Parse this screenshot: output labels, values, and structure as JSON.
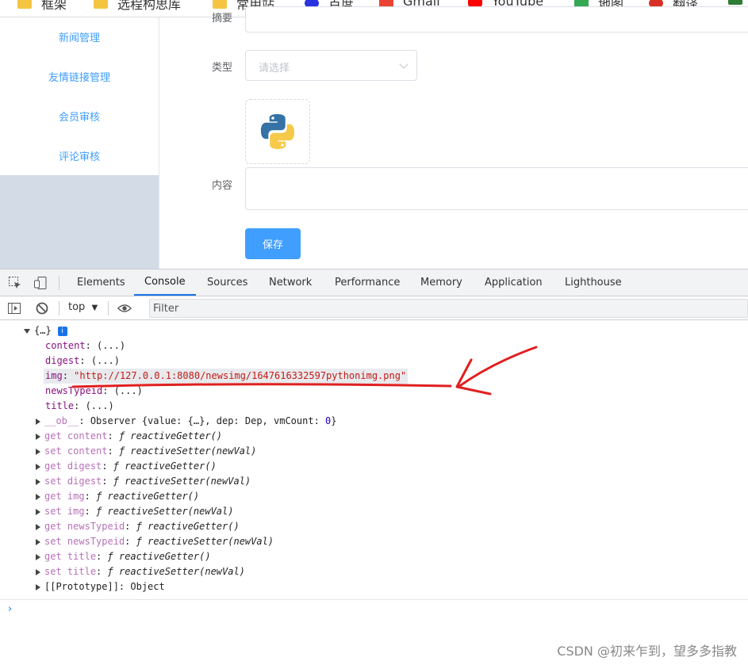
{
  "bookmarks": [
    {
      "label": "框架",
      "icon": "folder-icon"
    },
    {
      "label": "选程构思库",
      "icon": "folder-icon"
    },
    {
      "label": "常用站",
      "icon": "folder-icon"
    },
    {
      "label": "百度",
      "icon": "baidu-icon"
    },
    {
      "label": "Gmail",
      "icon": "gmail-icon"
    },
    {
      "label": "YouTube",
      "icon": "youtube-icon"
    },
    {
      "label": "地图",
      "icon": "maps-icon"
    },
    {
      "label": "翻译",
      "icon": "translate-icon"
    }
  ],
  "sidebar": {
    "items": [
      {
        "label": "新闻管理"
      },
      {
        "label": "友情链接管理"
      },
      {
        "label": "会员审核"
      },
      {
        "label": "评论审核"
      }
    ]
  },
  "form": {
    "digest_label": "摘要",
    "type_label": "类型",
    "type_placeholder": "请选择",
    "content_label": "内容",
    "save_label": "保存"
  },
  "devtools": {
    "tabs": [
      "Elements",
      "Console",
      "Sources",
      "Network",
      "Performance",
      "Memory",
      "Application",
      "Lighthouse"
    ],
    "active_tab": "Console",
    "context": "top",
    "filter_placeholder": "Filter"
  },
  "console": {
    "object_header": "{…}",
    "info_badge": "i",
    "props": [
      {
        "key": "content",
        "value": "(...)"
      },
      {
        "key": "digest",
        "value": "(...)"
      },
      {
        "key": "img",
        "value": "\"http://127.0.0.1:8080/newsimg/1647616332597pythonimg.png\""
      },
      {
        "key": "newsTypeid",
        "value": "(...)"
      },
      {
        "key": "title",
        "value": "(...)"
      }
    ],
    "observer": {
      "key": "__ob__",
      "value": "Observer {value: {…}, dep: Dep, vmCount: ",
      "count": "0",
      "close": "}"
    },
    "accessors": [
      {
        "kind": "get",
        "name": "content",
        "fn": "reactiveGetter()"
      },
      {
        "kind": "set",
        "name": "content",
        "fn": "reactiveSetter(newVal)"
      },
      {
        "kind": "get",
        "name": "digest",
        "fn": "reactiveGetter()"
      },
      {
        "kind": "set",
        "name": "digest",
        "fn": "reactiveSetter(newVal)"
      },
      {
        "kind": "get",
        "name": "img",
        "fn": "reactiveGetter()"
      },
      {
        "kind": "set",
        "name": "img",
        "fn": "reactiveSetter(newVal)"
      },
      {
        "kind": "get",
        "name": "newsTypeid",
        "fn": "reactiveGetter()"
      },
      {
        "kind": "set",
        "name": "newsTypeid",
        "fn": "reactiveSetter(newVal)"
      },
      {
        "kind": "get",
        "name": "title",
        "fn": "reactiveGetter()"
      },
      {
        "kind": "set",
        "name": "title",
        "fn": "reactiveSetter(newVal)"
      }
    ],
    "prototype": {
      "key": "[[Prototype]]",
      "value": "Object"
    },
    "f_symbol": "ƒ",
    "prompt": "›"
  },
  "annotation_color": "#e02020",
  "watermark": "CSDN @初来乍到，望多多指教"
}
